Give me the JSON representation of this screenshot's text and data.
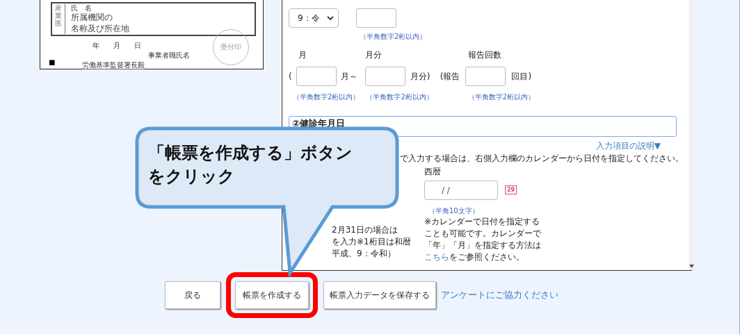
{
  "document_preview": {
    "side_label": "産業医",
    "name_label": "氏　名",
    "org_label": [
      "所属機関の",
      "名称及び所在地"
    ],
    "date_label": "年　　月　　日",
    "employer_label": "事業者職氏名",
    "addressee": "労働基準監督署長殿",
    "stamp_label": "受付印",
    "mark": "■"
  },
  "form": {
    "era_select": {
      "value": "9：令"
    },
    "year_hint": "（半角数字2桁以内）",
    "period_groups": [
      {
        "label": "月",
        "prefix": "(",
        "suffix": "月～",
        "hint": "（半角数字2桁以内）"
      },
      {
        "label": "月分",
        "suffix": "月分)",
        "hint": "（半角数字2桁以内）"
      },
      {
        "label": "報告回数",
        "prefix": "(報告",
        "suffix": "回目)",
        "hint": "（半角数字2桁以内）"
      }
    ],
    "section_title": "②健診年月日",
    "help_link": "入力項目の説明▼",
    "instruction": "で入力する場合は、右側入力欄のカレンダーから日付を指定してください。",
    "left_note_lines": [
      "2月31日の場合は",
      "を入力※1桁目は和暦",
      "平成、9：令和）"
    ],
    "date_label": "西暦",
    "date_value": "/ /",
    "calendar_day": "29",
    "date_hint": "（半角10文字）",
    "calendar_note": "※カレンダーで日付を指定することも可能です。カレンダーで「年」「月」を指定する方法は",
    "note_link": "こちら",
    "note_tail": "をご参照ください。"
  },
  "buttons": [
    {
      "label": "戻る",
      "highlighted": false
    },
    {
      "label": "帳票を作成する",
      "highlighted": true
    },
    {
      "label": "帳票入力データを保存する",
      "highlighted": false
    }
  ],
  "survey_link": "アンケートにご協力ください",
  "callout": {
    "lines": [
      "「帳票を作成する」ボタン",
      "をクリック"
    ]
  }
}
